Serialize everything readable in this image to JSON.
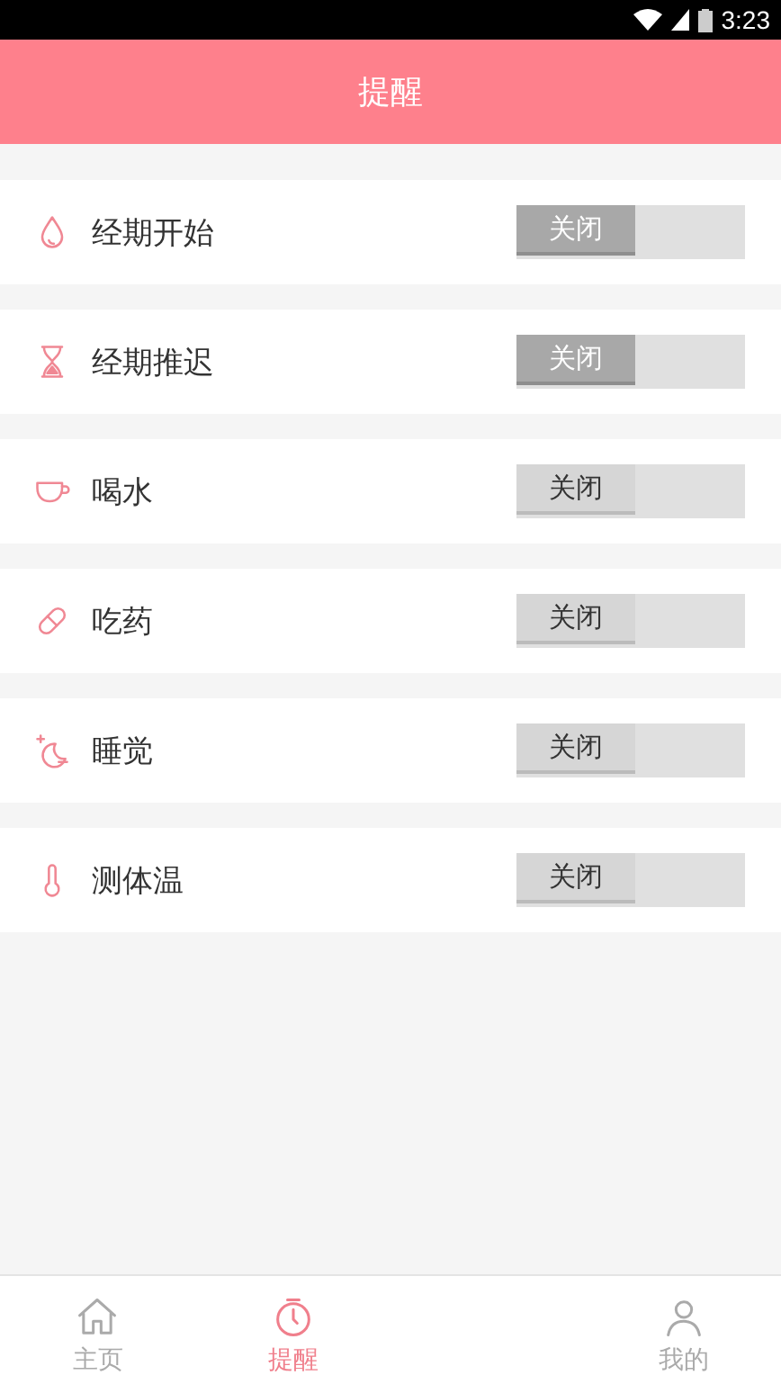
{
  "status_bar": {
    "time": "3:23"
  },
  "header": {
    "title": "提醒"
  },
  "reminders": [
    {
      "kind": "drop",
      "label": "经期开始",
      "switch_label": "关闭",
      "on": false,
      "disabled": true
    },
    {
      "kind": "hourglass",
      "label": "经期推迟",
      "switch_label": "关闭",
      "on": false,
      "disabled": true
    },
    {
      "kind": "cup",
      "label": "喝水",
      "switch_label": "关闭",
      "on": false,
      "disabled": false
    },
    {
      "kind": "pill",
      "label": "吃药",
      "switch_label": "关闭",
      "on": false,
      "disabled": false
    },
    {
      "kind": "moon",
      "label": "睡觉",
      "switch_label": "关闭",
      "on": false,
      "disabled": false
    },
    {
      "kind": "thermometer",
      "label": "测体温",
      "switch_label": "关闭",
      "on": false,
      "disabled": false
    }
  ],
  "bottom_nav": [
    {
      "kind": "home",
      "label": "主页",
      "selected": false
    },
    {
      "kind": "clock",
      "label": "提醒",
      "selected": true
    },
    {
      "kind": "person",
      "label": "我的",
      "selected": false
    }
  ]
}
